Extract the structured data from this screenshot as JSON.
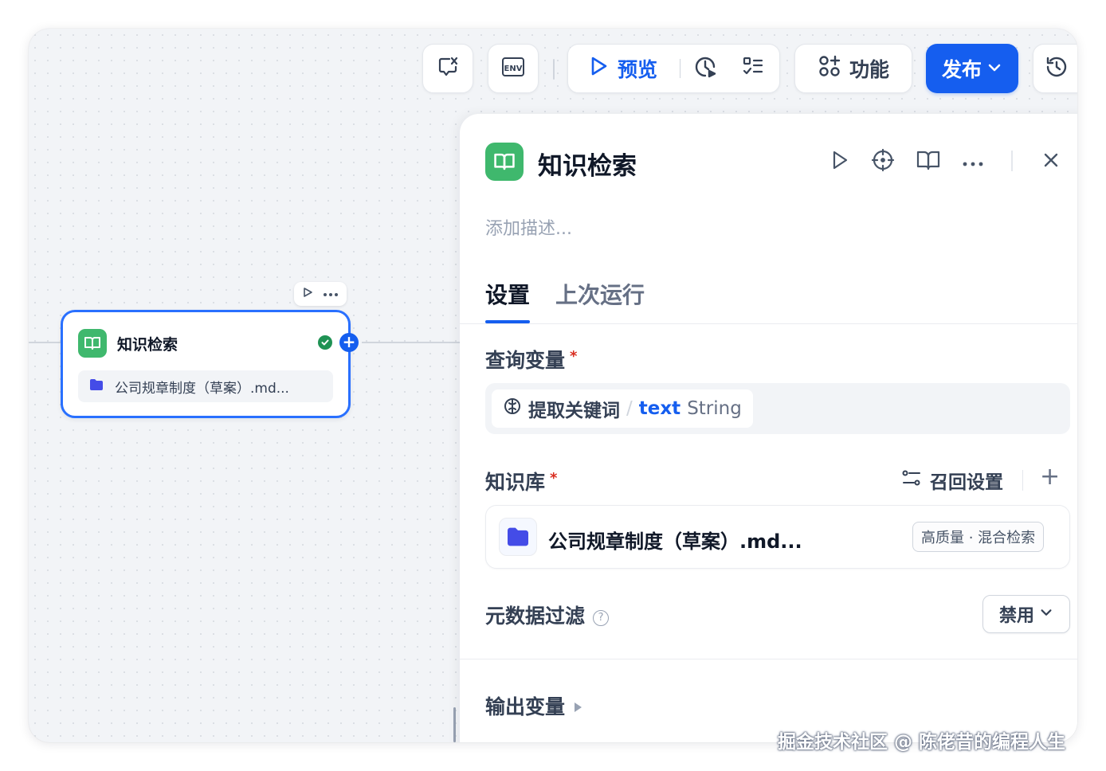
{
  "toolbar": {
    "preview_label": "预览",
    "features_label": "功能",
    "publish_label": "发布"
  },
  "canvas": {
    "node": {
      "title": "知识检索",
      "kb_item": "公司规章制度（草案）.md..."
    }
  },
  "panel": {
    "title": "知识检索",
    "description_placeholder": "添加描述...",
    "tabs": [
      {
        "label": "设置",
        "active": true
      },
      {
        "label": "上次运行",
        "active": false
      }
    ],
    "query_variable": {
      "label": "查询变量",
      "required": "*",
      "node_name": "提取关键词",
      "separator": "/",
      "field": "text",
      "type": "String"
    },
    "knowledge_base": {
      "label": "知识库",
      "required": "*",
      "recall_label": "召回设置",
      "add_label": "+",
      "item_name": "公司规章制度（草案）.md...",
      "badge": "高质量 · 混合检索"
    },
    "metadata_filter": {
      "label": "元数据过滤",
      "help": "?",
      "value": "禁用"
    },
    "output_variable": {
      "label": "输出变量"
    }
  },
  "watermark": "掘金技术社区 @ 陈佬昔的编程人生",
  "colors": {
    "accent": "#155eef",
    "node_icon": "#3fb86d",
    "required": "#d92d20",
    "success": "#1f9254",
    "folder": "#444ce7"
  }
}
